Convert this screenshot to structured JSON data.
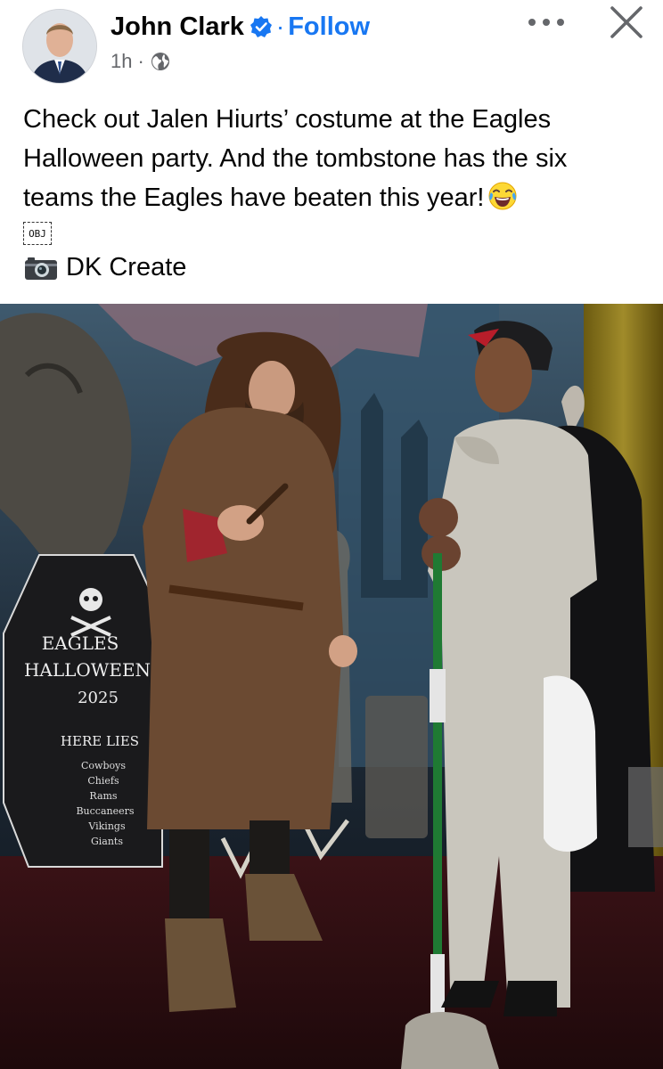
{
  "author": {
    "name": "John Clark",
    "follow_label": "Follow",
    "time": "1h",
    "separator": "·"
  },
  "post": {
    "text": "Check out Jalen Hiurts’ costume at the Eagles Halloween party. And the tombstone has the six teams the Eagles have beaten this year!",
    "obj_label": "OBJ",
    "credit": "DK Create"
  },
  "photo": {
    "tombstone": {
      "line1": "EAGLES",
      "line2": "HALLOWEEN",
      "year": "2025",
      "here_lies": "HERE LIES",
      "teams": [
        "Cowboys",
        "Chiefs",
        "Rams",
        "Buccaneers",
        "Vikings",
        "Giants"
      ]
    }
  },
  "colors": {
    "accent": "#1877f2",
    "secondary_text": "#65676b"
  },
  "icons": [
    "verified-badge-icon",
    "globe-icon",
    "more-options-icon",
    "close-icon",
    "laughing-emoji-icon",
    "camera-icon"
  ]
}
